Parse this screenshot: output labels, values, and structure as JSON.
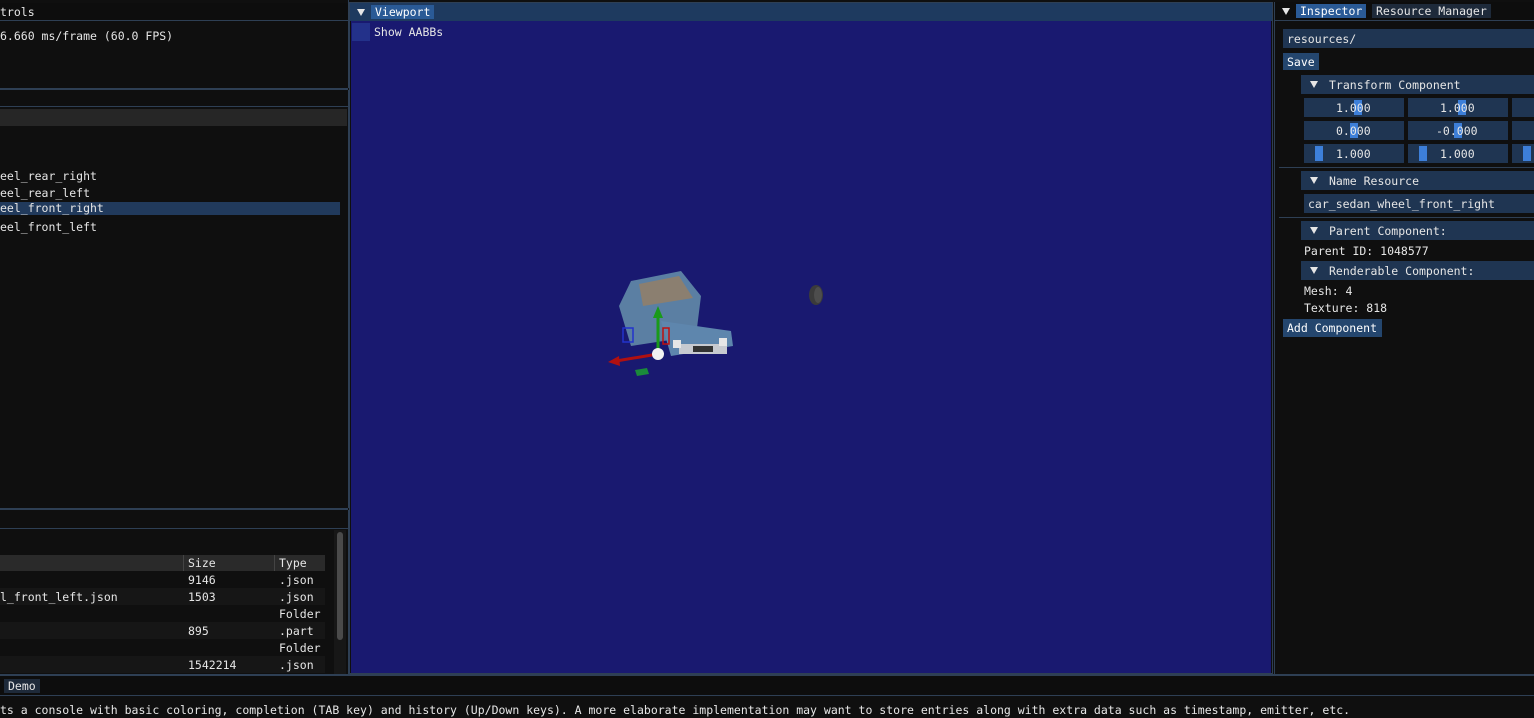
{
  "controls": {
    "title": "trols",
    "fps_text": "6.660 ms/frame (60.0 FPS)"
  },
  "hierarchy": {
    "items": [
      {
        "label": "eel_rear_right"
      },
      {
        "label": "eel_rear_left"
      },
      {
        "label": "eel_front_right",
        "selected": true
      },
      {
        "label": "eel_front_left"
      }
    ]
  },
  "files": {
    "columns": {
      "size": "Size",
      "type": "Type"
    },
    "rows": [
      {
        "name": "",
        "size": "9146",
        "type": ".json"
      },
      {
        "name": "l_front_left.json",
        "size": "1503",
        "type": ".json"
      },
      {
        "name": "",
        "size": "",
        "type": "Folder"
      },
      {
        "name": "",
        "size": "895",
        "type": ".part"
      },
      {
        "name": "",
        "size": "",
        "type": "Folder"
      },
      {
        "name": "",
        "size": "1542214",
        "type": ".json"
      }
    ]
  },
  "viewport": {
    "title": "Viewport",
    "show_aabbs": "Show AABBs",
    "bg_color": "#191970"
  },
  "inspector": {
    "tabs": [
      "Inspector",
      "Resource Manager"
    ],
    "path_value": "resources/",
    "save_label": "Save",
    "transform_header": "Transform Component",
    "transform_rows": [
      [
        "1.000",
        "1.000"
      ],
      [
        "0.000",
        "-0.000"
      ],
      [
        "1.000",
        "1.000"
      ]
    ],
    "name_header": "Name Resource",
    "name_value": "car_sedan_wheel_front_right",
    "parent_header": "Parent Component:",
    "parent_id": "Parent ID: 1048577",
    "renderable_header": "Renderable Component:",
    "mesh": "Mesh: 4",
    "texture": "Texture: 818",
    "add_component_label": "Add Component"
  },
  "console": {
    "tab_label": "Demo",
    "text": "ts a console with basic coloring, completion (TAB key) and history (Up/Down keys). A more elaborate implementation may want to store entries along with extra data such as timestamp, emitter, etc."
  }
}
